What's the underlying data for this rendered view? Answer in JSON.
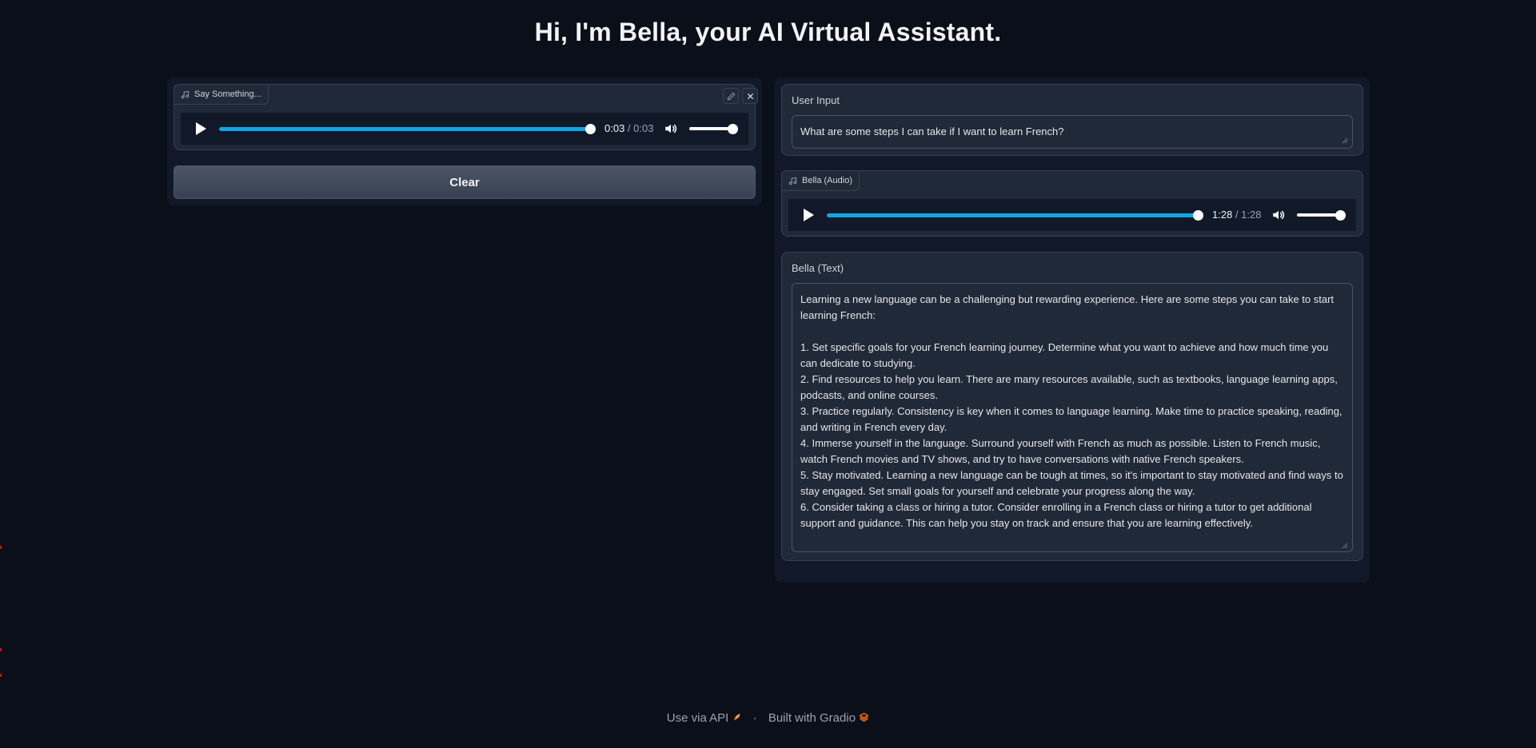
{
  "page": {
    "title": "Hi, I'm Bella, your AI Virtual Assistant."
  },
  "left": {
    "audio_input": {
      "label": "Say Something...",
      "icon": "music-note-icon",
      "current_time": "0:03",
      "total_time": "0:03",
      "progress": 1.0,
      "volume": 1.0
    },
    "clear_button": "Clear"
  },
  "right": {
    "user_input": {
      "label": "User Input",
      "value": "What are some steps I can take if I want to learn French?"
    },
    "audio_output": {
      "label": "Bella (Audio)",
      "icon": "music-note-icon",
      "current_time": "1:28",
      "total_time": "1:28",
      "progress": 1.0,
      "volume": 1.0
    },
    "text_output": {
      "label": "Bella (Text)",
      "value": "Learning a new language can be a challenging but rewarding experience. Here are some steps you can take to start learning French:\n\n1. Set specific goals for your French learning journey. Determine what you want to achieve and how much time you can dedicate to studying.\n2. Find resources to help you learn. There are many resources available, such as textbooks, language learning apps, podcasts, and online courses.\n3. Practice regularly. Consistency is key when it comes to language learning. Make time to practice speaking, reading, and writing in French every day.\n4. Immerse yourself in the language. Surround yourself with French as much as possible. Listen to French music, watch French movies and TV shows, and try to have conversations with native French speakers.\n5. Stay motivated. Learning a new language can be tough at times, so it's important to stay motivated and find ways to stay engaged. Set small goals for yourself and celebrate your progress along the way.\n6. Consider taking a class or hiring a tutor. Consider enrolling in a French class or hiring a tutor to get additional support and guidance. This can help you stay on track and ensure that you are learning effectively."
    }
  },
  "footer": {
    "api_link": "Use via API",
    "separator": "·",
    "built_with": "Built with Gradio",
    "api_icon": "rocket-icon",
    "gradio_icon": "gradio-logo-icon"
  },
  "colors": {
    "background": "#0b0f19",
    "panel": "#111827",
    "block": "#1f2937",
    "accent_progress": "#0ea5e9",
    "gradio_orange": "#f97316"
  }
}
